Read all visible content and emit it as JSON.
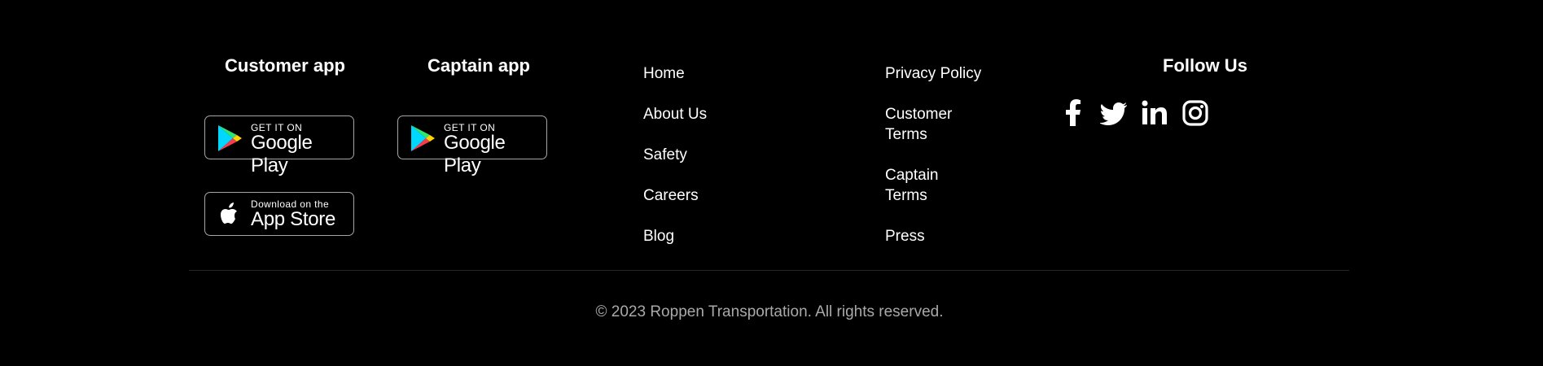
{
  "apps": {
    "customer_title": "Customer app",
    "captain_title": "Captain app",
    "google_play": {
      "small": "GET IT ON",
      "big": "Google Play"
    },
    "app_store": {
      "small": "Download on the",
      "big": "App Store"
    }
  },
  "links_col1": [
    "Home",
    "About Us",
    "Safety",
    "Careers",
    "Blog"
  ],
  "links_col2": [
    "Privacy Policy",
    "Customer\nTerms",
    "Captain\nTerms",
    "Press"
  ],
  "follow": {
    "title": "Follow Us",
    "icons": [
      "facebook-icon",
      "twitter-icon",
      "linkedin-icon",
      "instagram-icon"
    ]
  },
  "footer": {
    "copyright": "© 2023 Roppen Transportation. All rights reserved."
  },
  "colors": {
    "background": "#000000",
    "text": "#ffffff",
    "muted": "#a9a9a9",
    "badge_border": "#a6a6a6"
  }
}
